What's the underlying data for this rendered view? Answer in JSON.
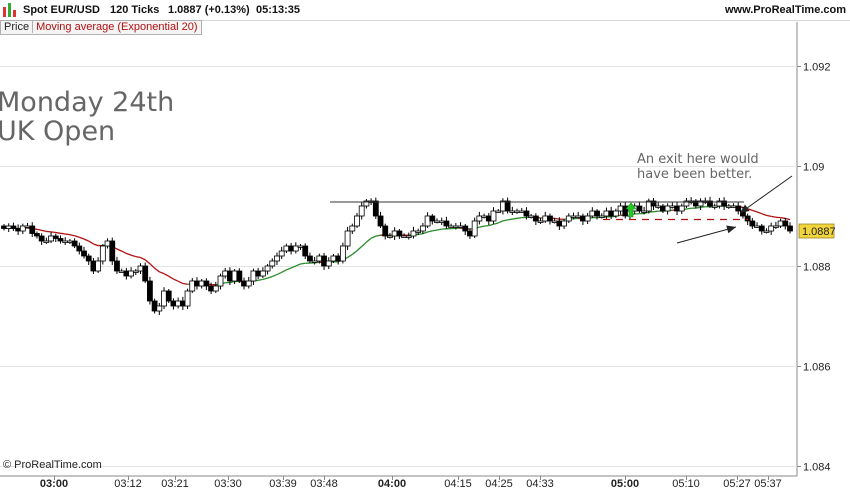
{
  "header": {
    "instrument": "Spot EUR/USD",
    "interval": "120 Ticks",
    "last": "1.0887 (+0.13%)",
    "time": "05:13:35",
    "website": "www.ProRealTime.com"
  },
  "legend": {
    "price": "Price",
    "indicator": "Moving average (Exponential 20)"
  },
  "overlay": {
    "line1": "Monday 24th",
    "line2": "UK Open"
  },
  "annotation": {
    "line1": "An exit here would",
    "line2": "have been better."
  },
  "copyright": "© ProRealTime.com",
  "colors": {
    "candle_up": "#ffffff",
    "candle_down": "#000000",
    "ema_up": "#2a8a2a",
    "ema_down": "#b01010",
    "marker": "#22cc22",
    "price_tag": "#f2d43c"
  },
  "chart_data": {
    "type": "candlestick",
    "title": "Spot EUR/USD",
    "ylim": [
      1.0838,
      1.094
    ],
    "y_ticks": [
      "1.084",
      "1.086",
      "1.088",
      "1.09",
      "1.092"
    ],
    "x_ticks": [
      "03:00",
      "03:12",
      "03:21",
      "03:30",
      "03:39",
      "03:48",
      "04:00",
      "04:15",
      "04:25",
      "04:33",
      "05:00",
      "05:10",
      "05:27",
      "05:37"
    ],
    "x_ticks_bold": [
      "03:00",
      "04:00",
      "05:00"
    ],
    "last_price": "1.0887",
    "resistance_level": 1.08928,
    "exit_level": 1.08893,
    "grid": true,
    "close_series": [
      1.08875,
      1.0888,
      1.08875,
      1.0887,
      1.0888,
      1.0888,
      1.08865,
      1.0886,
      1.0885,
      1.0885,
      1.0886,
      1.08855,
      1.0885,
      1.0885,
      1.0885,
      1.0884,
      1.0883,
      1.0882,
      1.0881,
      1.0879,
      1.0881,
      1.0884,
      1.0885,
      1.0881,
      1.0879,
      1.0879,
      1.0878,
      1.0879,
      1.0879,
      1.088,
      1.0877,
      1.0873,
      1.0871,
      1.0872,
      1.0875,
      1.0873,
      1.0872,
      1.0873,
      1.0872,
      1.0875,
      1.0877,
      1.0876,
      1.0877,
      1.0876,
      1.0875,
      1.0876,
      1.0878,
      1.0879,
      1.0877,
      1.0879,
      1.0877,
      1.0876,
      1.0877,
      1.0879,
      1.0878,
      1.0879,
      1.088,
      1.0881,
      1.0882,
      1.0883,
      1.0884,
      1.0883,
      1.0884,
      1.0884,
      1.0882,
      1.0881,
      1.0881,
      1.0882,
      1.088,
      1.0881,
      1.0882,
      1.0881,
      1.0884,
      1.0887,
      1.0888,
      1.089,
      1.0892,
      1.0893,
      1.0893,
      1.089,
      1.0888,
      1.0886,
      1.0886,
      1.0887,
      1.0886,
      1.0886,
      1.0886,
      1.0887,
      1.0887,
      1.0888,
      1.089,
      1.0889,
      1.0889,
      1.0889,
      1.0888,
      1.0888,
      1.0888,
      1.0888,
      1.0887,
      1.0886,
      1.0889,
      1.089,
      1.089,
      1.0889,
      1.0891,
      1.0891,
      1.0893,
      1.0891,
      1.0891,
      1.0891,
      1.0891,
      1.089,
      1.089,
      1.0889,
      1.0889,
      1.089,
      1.0889,
      1.0889,
      1.0888,
      1.0889,
      1.089,
      1.089,
      1.089,
      1.0889,
      1.089,
      1.0891,
      1.089,
      1.089,
      1.0891,
      1.089,
      1.0891,
      1.0892,
      1.089,
      1.0891,
      1.0892,
      1.0891,
      1.0891,
      1.0893,
      1.0892,
      1.0892,
      1.0891,
      1.0892,
      1.0892,
      1.0891,
      1.0892,
      1.0893,
      1.0893,
      1.0892,
      1.0893,
      1.0893,
      1.0892,
      1.0892,
      1.0893,
      1.0892,
      1.0892,
      1.0892,
      1.0891,
      1.089,
      1.0889,
      1.0888,
      1.0888,
      1.0887,
      1.0887,
      1.0888,
      1.0888,
      1.0889,
      1.0888,
      1.0887
    ]
  }
}
